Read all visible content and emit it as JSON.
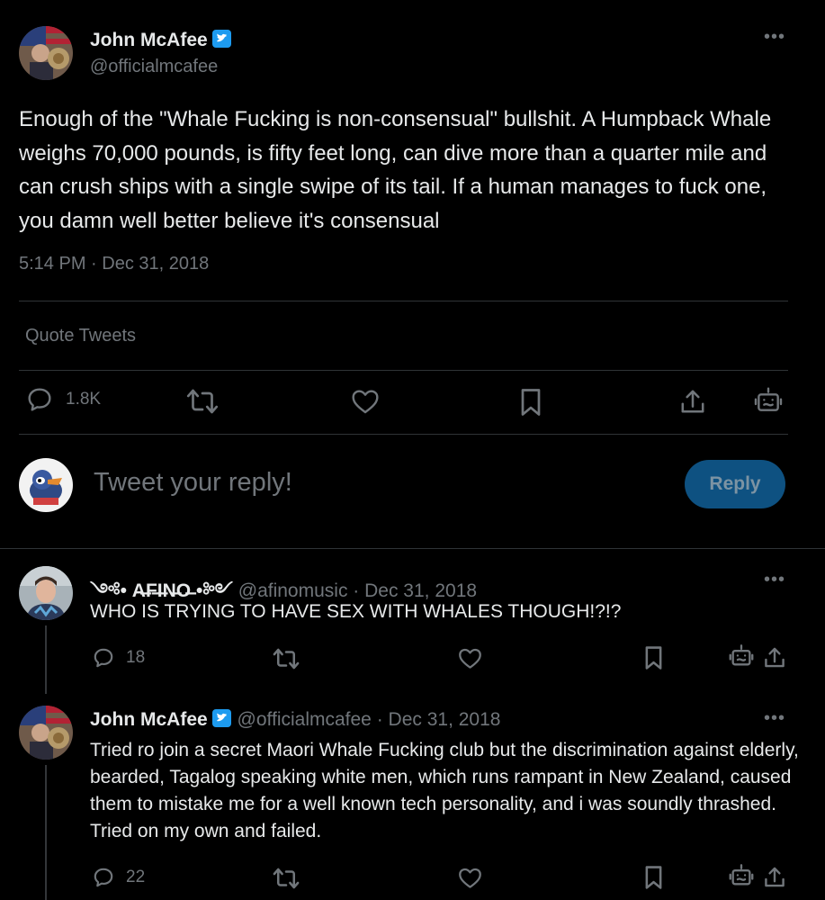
{
  "main_tweet": {
    "author": "John McAfee",
    "handle": "@officialmcafee",
    "text": "Enough of the \"Whale Fucking is non-consensual\" bullshit. A Humpback Whale weighs 70,000 pounds, is fifty feet long, can dive more than a quarter mile and can crush ships with a single swipe of its tail. If a human manages to fuck one, you damn well better believe it's consensual",
    "timestamp": "5:14 PM · Dec 31, 2018",
    "quote_tweets_label": "Quote Tweets",
    "replies_count": "1.8K"
  },
  "composer": {
    "placeholder": "Tweet your reply!",
    "reply_button": "Reply"
  },
  "replies": [
    {
      "author": "༺• A̶F̶I̶N̶O̶ •༻",
      "handle": "@afinomusic",
      "date": "· Dec 31, 2018",
      "text": "WHO IS TRYING TO HAVE SEX WITH WHALES THOUGH!?!?",
      "replies_count": "18"
    },
    {
      "author": "John McAfee",
      "handle": "@officialmcafee",
      "date": "· Dec 31, 2018",
      "text": "Tried ro join a secret Maori Whale Fucking club but the discrimination against elderly, bearded, Tagalog speaking white men, which runs rampant in New Zealand, caused them to mistake me for a well known tech personality, and  i was soundly thrashed. Tried on my own and failed.",
      "replies_count": "22"
    }
  ],
  "colors": {
    "background": "#000000",
    "text": "#e7e9ea",
    "muted": "#71767b",
    "divider": "#2f3336",
    "verified": "#1d9bf0",
    "reply_button_bg": "#0e5181"
  },
  "icons": [
    "verified-badge-icon",
    "more-icon",
    "reply-icon",
    "retweet-icon",
    "like-icon",
    "bookmark-icon",
    "share-icon",
    "bot-icon"
  ]
}
